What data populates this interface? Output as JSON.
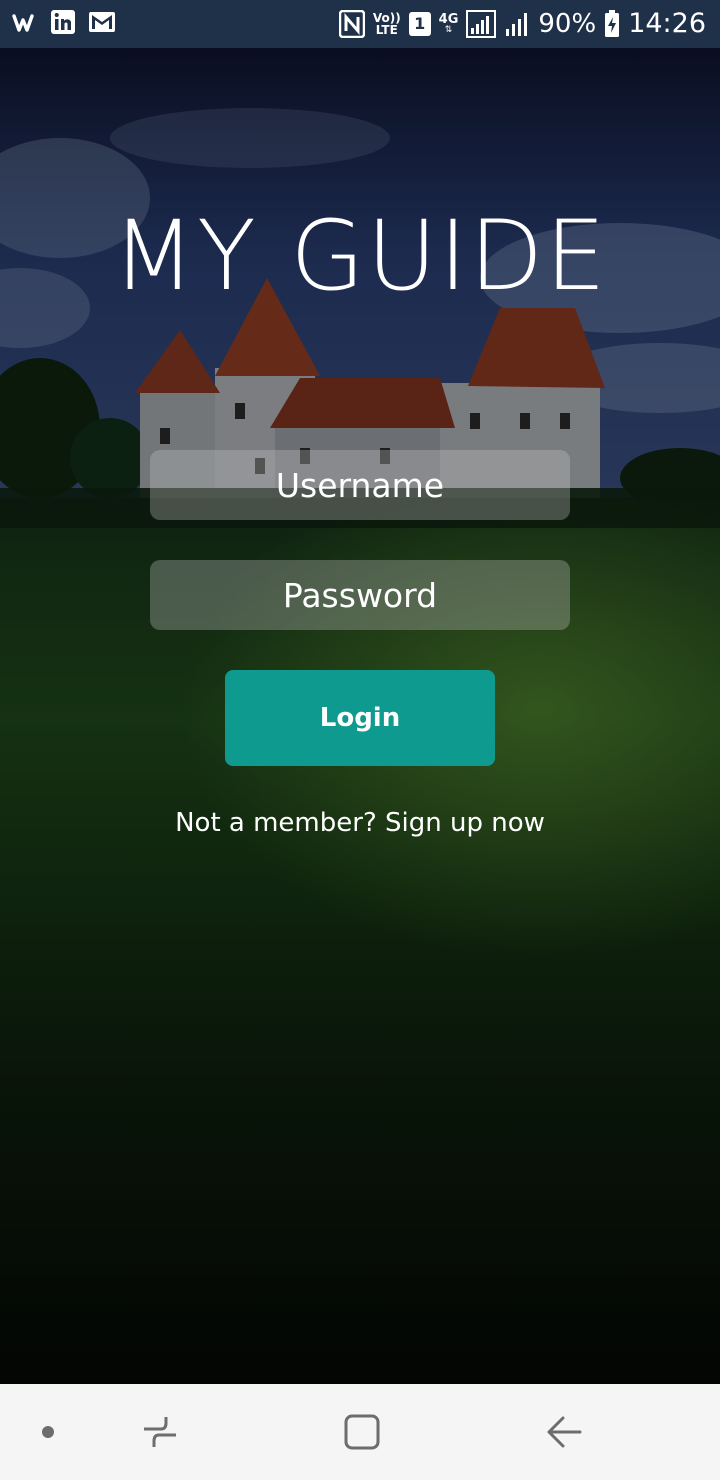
{
  "status_bar": {
    "left_icons": [
      "wish-icon",
      "linkedin-icon",
      "gmail-icon"
    ],
    "network_label": "4G",
    "volte_label_top": "Vo))",
    "volte_label_bottom": "LTE",
    "sim_label": "1",
    "battery_percent": "90%",
    "time": "14:26"
  },
  "app": {
    "title": "MY GUIDE",
    "username_placeholder": "Username",
    "password_placeholder": "Password",
    "login_label": "Login",
    "signup_text": "Not a member? Sign up now",
    "accent_color": "#0e9a8e"
  },
  "nav_bar": {
    "buttons": [
      "dot-icon",
      "recent-apps-icon",
      "home-icon",
      "back-icon"
    ]
  }
}
